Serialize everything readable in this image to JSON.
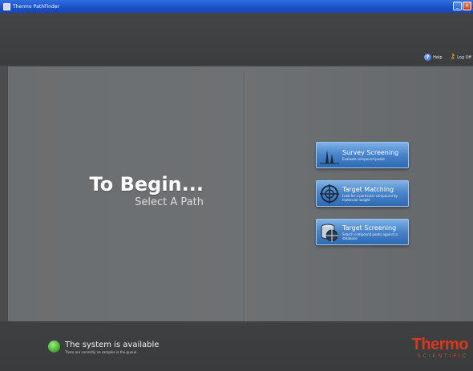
{
  "window": {
    "title": "Thermo PathFinder",
    "minimize_glyph": "_",
    "close_glyph": "×"
  },
  "header": {
    "help_label": "Help",
    "help_icon": "help-icon",
    "logoff_label": "Log Off",
    "logoff_icon": "key-icon"
  },
  "main": {
    "title": "To Begin...",
    "subtitle": "Select A Path",
    "paths": [
      {
        "label": "Survey Screening",
        "description": "Evaluate compound peaks",
        "icon": "peaks-icon"
      },
      {
        "label": "Target Matching",
        "description": "Look for a particular compound by molecular weight",
        "icon": "target-icon"
      },
      {
        "label": "Target Screening",
        "description": "Search compound peaks against a database",
        "icon": "database-target-icon"
      }
    ]
  },
  "footer": {
    "status_title": "The system is available",
    "status_sub": "There are currently no samples in the queue",
    "status_color": "#3ca52a",
    "logo_main": "Thermo",
    "logo_sub": "SCIENTIFIC",
    "brand_color": "#d63a1e"
  }
}
